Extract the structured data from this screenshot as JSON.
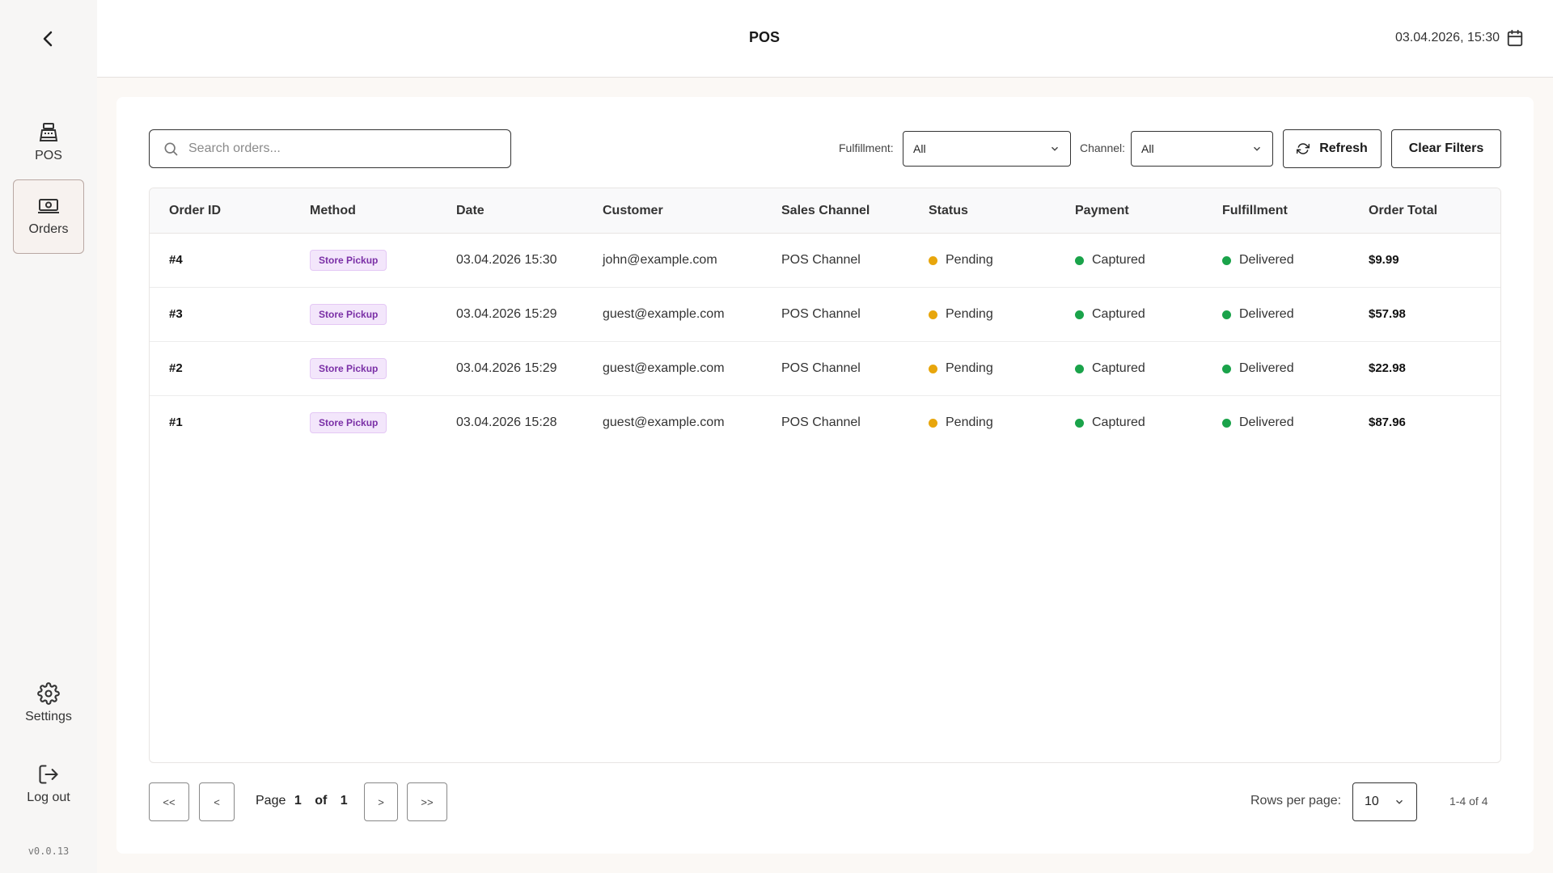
{
  "header": {
    "title": "POS",
    "datetime": "03.04.2026, 15:30"
  },
  "sidebar": {
    "items": [
      {
        "label": "POS",
        "icon": "cash-register-icon"
      },
      {
        "label": "Orders",
        "icon": "money-icon"
      },
      {
        "label": "Settings",
        "icon": "gear-icon"
      },
      {
        "label": "Log out",
        "icon": "logout-icon"
      }
    ],
    "version": "v0.0.13"
  },
  "toolbar": {
    "search_placeholder": "Search orders...",
    "fulfillment_label": "Fulfillment:",
    "fulfillment_value": "All",
    "channel_label": "Channel:",
    "channel_value": "All",
    "refresh_label": "Refresh",
    "clear_label": "Clear Filters"
  },
  "table": {
    "headers": [
      "Order ID",
      "Method",
      "Date",
      "Customer",
      "Sales Channel",
      "Status",
      "Payment",
      "Fulfillment",
      "Order Total"
    ],
    "rows": [
      {
        "id": "#4",
        "method": "Store Pickup",
        "date": "03.04.2026 15:30",
        "customer": "john@example.com",
        "channel": "POS Channel",
        "status": "Pending",
        "payment": "Captured",
        "fulfillment": "Delivered",
        "total": "$9.99"
      },
      {
        "id": "#3",
        "method": "Store Pickup",
        "date": "03.04.2026 15:29",
        "customer": "guest@example.com",
        "channel": "POS Channel",
        "status": "Pending",
        "payment": "Captured",
        "fulfillment": "Delivered",
        "total": "$57.98"
      },
      {
        "id": "#2",
        "method": "Store Pickup",
        "date": "03.04.2026 15:29",
        "customer": "guest@example.com",
        "channel": "POS Channel",
        "status": "Pending",
        "payment": "Captured",
        "fulfillment": "Delivered",
        "total": "$22.98"
      },
      {
        "id": "#1",
        "method": "Store Pickup",
        "date": "03.04.2026 15:28",
        "customer": "guest@example.com",
        "channel": "POS Channel",
        "status": "Pending",
        "payment": "Captured",
        "fulfillment": "Delivered",
        "total": "$87.96"
      }
    ]
  },
  "pagination": {
    "first": "<<",
    "prev": "<",
    "next": ">",
    "last": ">>",
    "page_word": "Page",
    "page": "1",
    "of_word": "of",
    "total_pages": "1",
    "rows_per_page_label": "Rows per page:",
    "rows_per_page": "10",
    "range": "1-4 of 4"
  },
  "colors": {
    "pending": "#e8a60c",
    "captured": "#1aa34a",
    "delivered": "#1aa34a",
    "badge_text": "#7a2fa6"
  }
}
